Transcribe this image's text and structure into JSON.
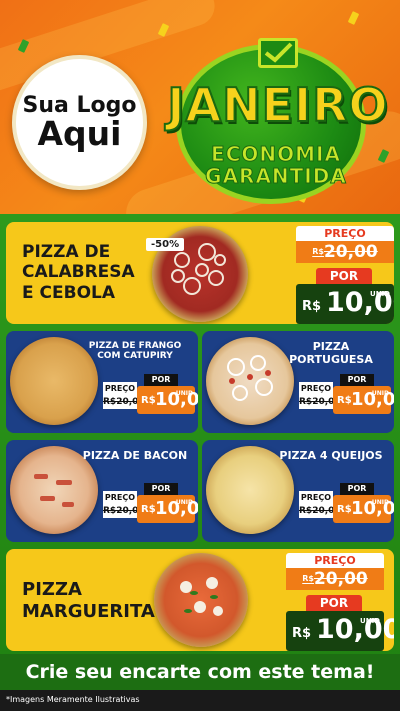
{
  "header": {
    "logo_line1": "Sua Logo",
    "logo_line2": "Aqui",
    "title_main": "JANEIRO",
    "title_sub1": "ECONOMIA",
    "title_sub2": "GARANTIDA"
  },
  "featured": [
    {
      "name_lines": [
        "PIZZA DE",
        "CALABRESA",
        "E CEBOLA"
      ],
      "discount": "-50%",
      "price_label": "PREÇO",
      "old_currency": "R$",
      "old_price": "20,00",
      "por_label": "POR",
      "currency": "R$",
      "new_price": "10,00",
      "unit": "UNID"
    },
    {
      "name_lines": [
        "PIZZA",
        "MARGUERITA"
      ],
      "price_label": "PREÇO",
      "old_currency": "R$",
      "old_price": "20,00",
      "por_label": "POR",
      "currency": "R$",
      "new_price": "10,00",
      "unit": "UNID"
    }
  ],
  "items": [
    {
      "name": "PIZZA DE FRANGO COM CATUPIRY",
      "price_label": "PREÇO",
      "old_price": "R$20,00",
      "por_label": "POR",
      "currency": "R$",
      "new_price": "10,00",
      "unit": "UNID"
    },
    {
      "name": "PIZZA PORTUGUESA",
      "price_label": "PREÇO",
      "old_price": "R$20,00",
      "por_label": "POR",
      "currency": "R$",
      "new_price": "10,00",
      "unit": "UNID"
    },
    {
      "name": "PIZZA DE BACON",
      "price_label": "PREÇO",
      "old_price": "R$20,00",
      "por_label": "POR",
      "currency": "R$",
      "new_price": "10,00",
      "unit": "UNID"
    },
    {
      "name": "PIZZA 4 QUEIJOS",
      "price_label": "PREÇO",
      "old_price": "R$20,00",
      "por_label": "POR",
      "currency": "R$",
      "new_price": "10,00",
      "unit": "UNID"
    }
  ],
  "cta": "Crie seu encarte com este tema!",
  "footer_note": "*Imagens Meramente Ilustrativas",
  "colors": {
    "orange": "#f07016",
    "green": "#1f8010",
    "yellow": "#f6c81a",
    "blue": "#1c3f86",
    "red": "#e63a20"
  }
}
